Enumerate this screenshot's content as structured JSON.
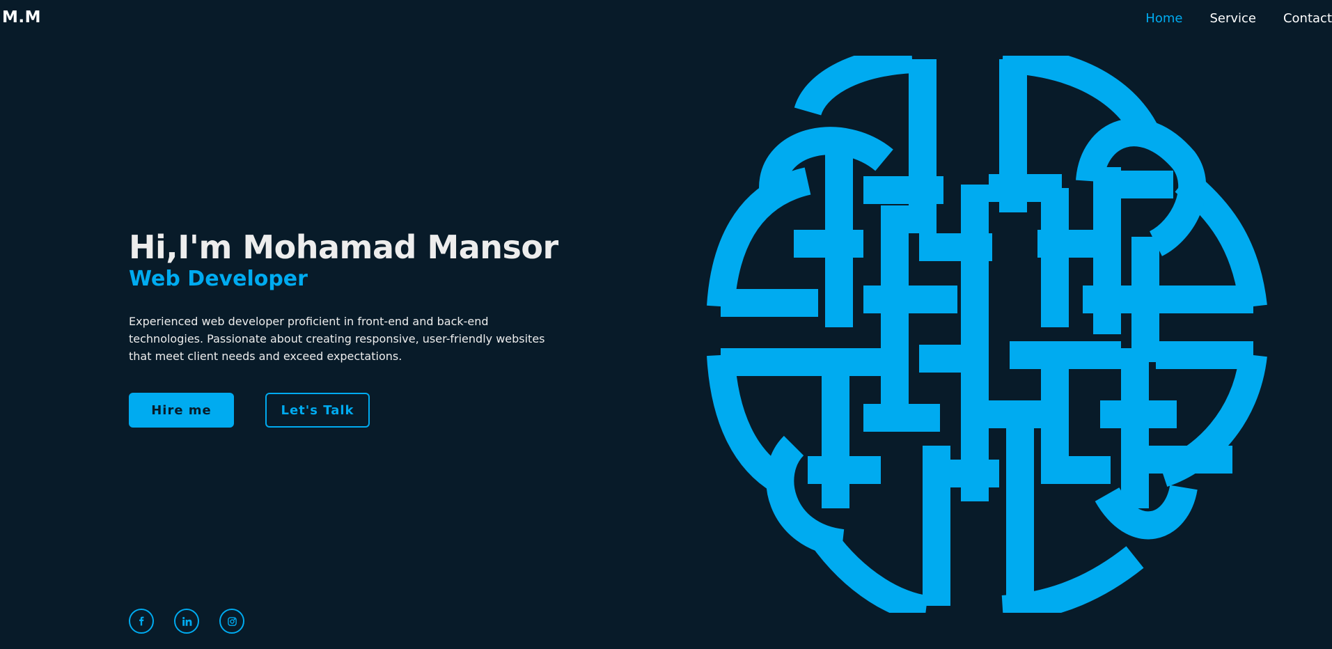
{
  "brand": {
    "logo": "M.M"
  },
  "nav": {
    "items": [
      "Home",
      "Service",
      "Contact"
    ],
    "active": "Home"
  },
  "hero": {
    "greeting": "Hi,I'm Mohamad Mansor",
    "role": "Web Developer",
    "description": "Experienced web developer proficient in front-end and back-end technologies. Passionate about creating responsive, user-friendly websites that meet client needs and exceed expectations.",
    "primary_button": "Hire me",
    "secondary_button": "Let's Talk"
  },
  "social": {
    "icons": [
      "facebook-icon",
      "linkedin-icon",
      "instagram-icon"
    ]
  },
  "illustration": {
    "icon": "celtic-knot"
  },
  "colors": {
    "background": "#081b29",
    "accent": "#00abf0",
    "text": "#ededed"
  }
}
